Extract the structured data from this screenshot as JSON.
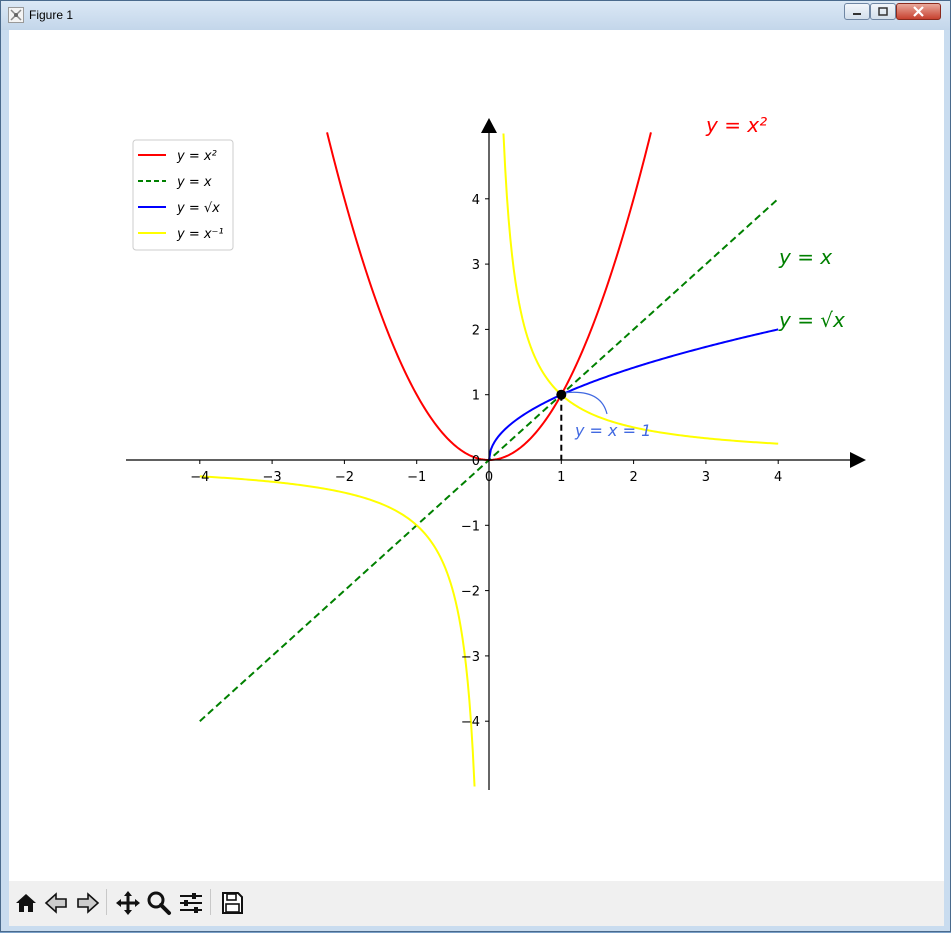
{
  "window": {
    "title": "Figure 1"
  },
  "toolbar": {
    "buttons": [
      "home",
      "back",
      "forward",
      "pan",
      "zoom",
      "configure-subplots",
      "save"
    ]
  },
  "chart_data": {
    "type": "line",
    "title": "",
    "xlabel": "",
    "ylabel": "",
    "xlim": [
      -5,
      5
    ],
    "ylim": [
      -5,
      5
    ],
    "x_ticks": [
      "−4",
      "−3",
      "−2",
      "−1",
      "0",
      "1",
      "2",
      "3",
      "4"
    ],
    "y_ticks": [
      "−4",
      "−3",
      "−2",
      "−1",
      "0",
      "1",
      "2",
      "3",
      "4"
    ],
    "grid": false,
    "legend_position": "top-left",
    "series": [
      {
        "name": "y = x²",
        "color": "#ff0000",
        "style": "solid",
        "x": [
          -2.24,
          -2,
          -1.5,
          -1,
          -0.5,
          0,
          0.5,
          1,
          1.5,
          2,
          2.24
        ],
        "y": [
          5.0,
          4.0,
          2.25,
          1.0,
          0.25,
          0,
          0.25,
          1.0,
          2.25,
          4.0,
          5.0
        ]
      },
      {
        "name": "y = x",
        "color": "#008000",
        "style": "dashed",
        "x": [
          -4,
          4
        ],
        "y": [
          -4,
          4
        ]
      },
      {
        "name": "y = √x",
        "color": "#0000ff",
        "style": "solid",
        "x": [
          0,
          0.1,
          0.25,
          0.5,
          1,
          2,
          3,
          4
        ],
        "y": [
          0,
          0.32,
          0.5,
          0.71,
          1.0,
          1.41,
          1.73,
          2.0
        ]
      },
      {
        "name": "y = x⁻¹",
        "color": "#ffff00",
        "style": "solid",
        "x": [
          -4,
          -3,
          -2,
          -1,
          -0.5,
          -0.4,
          -0.3,
          -0.25,
          -0.2,
          0.2,
          0.25,
          0.3,
          0.4,
          0.5,
          1,
          2,
          3,
          4
        ],
        "y": [
          -0.25,
          -0.33,
          -0.5,
          -1.0,
          -2.0,
          -2.5,
          -3.33,
          -4.0,
          -5.0,
          5.0,
          4.0,
          3.33,
          2.5,
          2.0,
          1.0,
          0.5,
          0.33,
          0.25
        ]
      }
    ],
    "point": {
      "x": 1,
      "y": 1
    },
    "annotations": {
      "square_label": "y = x²",
      "linear_label": "y = x",
      "sqrt_label": "y = √x",
      "point_label": "y = x = 1"
    },
    "colors": {
      "square_label": "#ff0000",
      "linear_label": "#008000",
      "sqrt_label": "#008000",
      "point_label": "#4169e1"
    }
  }
}
